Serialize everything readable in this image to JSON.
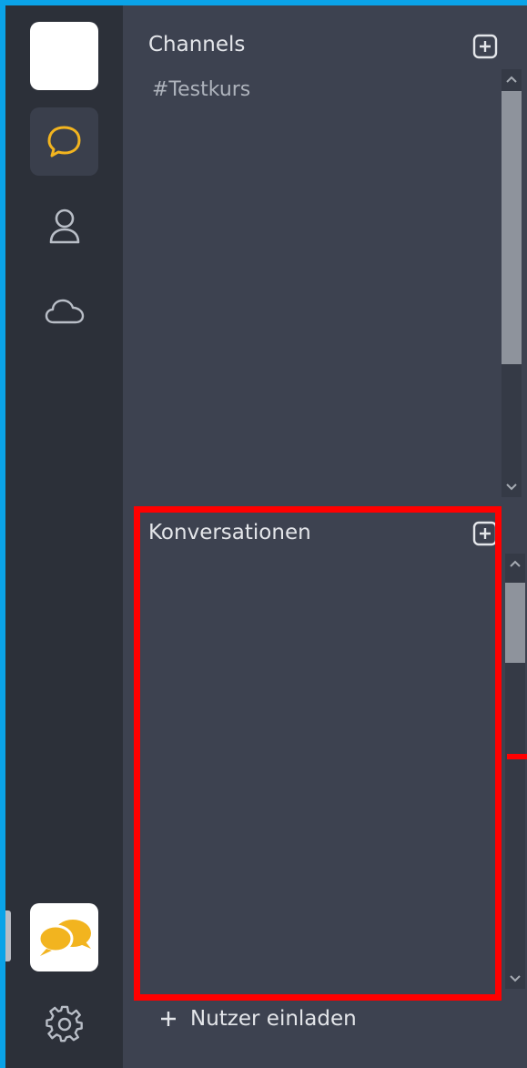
{
  "rail": {
    "items": [
      {
        "name": "workspace",
        "icon": "blank-tile"
      },
      {
        "name": "chats",
        "icon": "speech-bubble-icon",
        "active": true,
        "color": "#f2b41f"
      },
      {
        "name": "contacts",
        "icon": "user-icon"
      },
      {
        "name": "cloud",
        "icon": "cloud-icon"
      }
    ],
    "app_logo": "chat-bubbles-logo",
    "settings": "gear-icon"
  },
  "channels": {
    "title": "Channels",
    "items": [
      "#Testkurs"
    ]
  },
  "conversations": {
    "title": "Konversationen",
    "items": []
  },
  "footer": {
    "invite_label": "Nutzer einladen"
  },
  "colors": {
    "accent": "#f2b41f",
    "highlight": "#ff0000",
    "window_border": "#0aa3e8"
  }
}
